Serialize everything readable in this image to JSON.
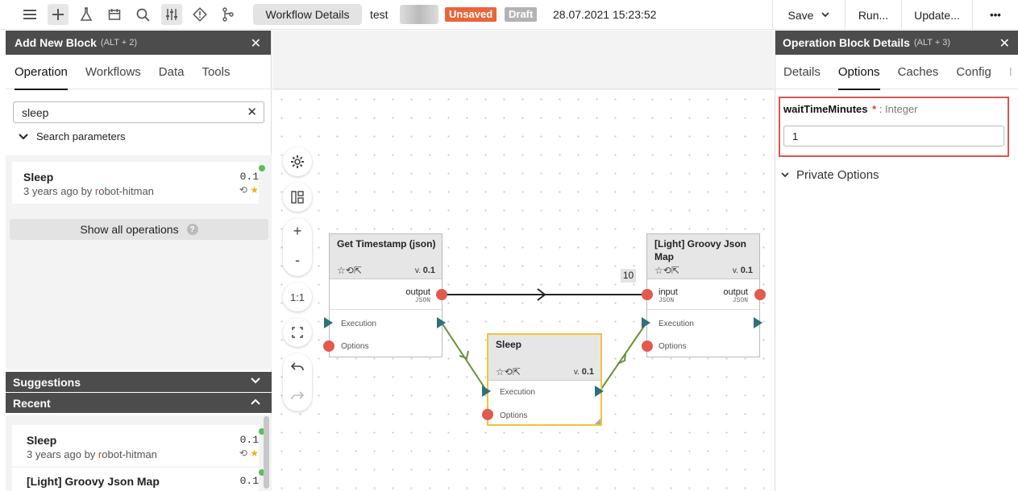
{
  "topbar": {
    "workflow_details_label": "Workflow Details",
    "workflow_name": "test",
    "unsaved_badge": "Unsaved",
    "draft_badge": "Draft",
    "timestamp": "28.07.2021 15:23:52",
    "save_label": "Save",
    "run_label": "Run...",
    "update_label": "Update...",
    "more_label": "•••"
  },
  "left_panel": {
    "title": "Add New Block",
    "hint": "(ALT + 2)",
    "tabs": [
      "Operation",
      "Workflows",
      "Data",
      "Tools"
    ],
    "search_value": "sleep",
    "search_params_label": "Search parameters",
    "result": {
      "title": "Sleep",
      "version": "0.1",
      "subtitle_prefix": "3 years ago",
      "by": "by",
      "author_first": "r",
      "author_rest": "obot-hitman"
    },
    "show_all_label": "Show all operations",
    "show_all_help": "?",
    "suggestions_label": "Suggestions",
    "recent_label": "Recent",
    "recent_items": [
      {
        "title": "Sleep",
        "version": "0.1",
        "subtitle_prefix": "3 years ago",
        "by": "by",
        "author_first": "r",
        "author_rest": "obot-hitman"
      },
      {
        "title": "[Light] Groovy Json Map",
        "version": "0.1"
      }
    ]
  },
  "canvas": {
    "controls": {
      "fit_label": "1:1",
      "zoom_in": "+",
      "zoom_out": "-"
    },
    "connection_count": "10",
    "blocks": {
      "get_timestamp": {
        "title": "Get Timestamp (json)",
        "version_prefix": "v.",
        "version": "0.1",
        "output_label": "output",
        "output_type": "JSON",
        "execution_label": "Execution",
        "options_label": "Options"
      },
      "sleep": {
        "title": "Sleep",
        "version_prefix": "v.",
        "version": "0.1",
        "execution_label": "Execution",
        "options_label": "Options"
      },
      "groovy": {
        "title": "[Light] Groovy Json Map",
        "version_prefix": "v.",
        "version": "0.1",
        "input_label": "input",
        "input_type": "JSON",
        "output_label": "output",
        "output_type": "JSON",
        "execution_label": "Execution",
        "options_label": "Options"
      }
    }
  },
  "right_panel": {
    "title": "Operation Block Details",
    "hint": "(ALT + 3)",
    "tabs": [
      "Details",
      "Options",
      "Caches",
      "Config",
      "I"
    ],
    "param_name": "waitTimeMinutes",
    "param_required": "*",
    "param_type": ": Integer",
    "param_value": "1",
    "private_options_label": "Private Options"
  },
  "icons": {
    "menu": "menu-icon",
    "add": "plus-icon",
    "flask": "flask-icon",
    "calendar": "calendar-icon",
    "search": "search-icon",
    "sliders": "sliders-icon",
    "diamond": "diamond-warning-icon",
    "git": "git-branch-icon"
  }
}
